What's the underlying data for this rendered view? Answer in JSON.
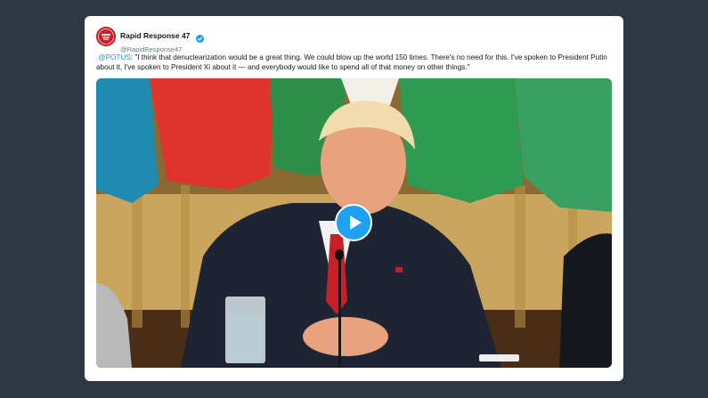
{
  "tweet": {
    "account": {
      "display_name": "Rapid Response 47",
      "handle": "@RapidResponse47",
      "avatar_icon": "red-seal-avatar",
      "verified_icon": "verified-badge-icon"
    },
    "mention": ".@POTUS",
    "body": ": \"I think that denuclearization would be a great thing. We could blow up the world 150 times. There's no need for this. I've spoken to President Putin about it, I've spoken to President Xi about it — and everybody would like to spend all of that money on other things.\"",
    "media": {
      "type": "video",
      "play_icon": "play-icon"
    }
  },
  "colors": {
    "background": "#2f3744",
    "card": "#ffffff",
    "link": "#1b95e0",
    "play_button": "#1da1f2",
    "avatar": "#c8202a"
  }
}
